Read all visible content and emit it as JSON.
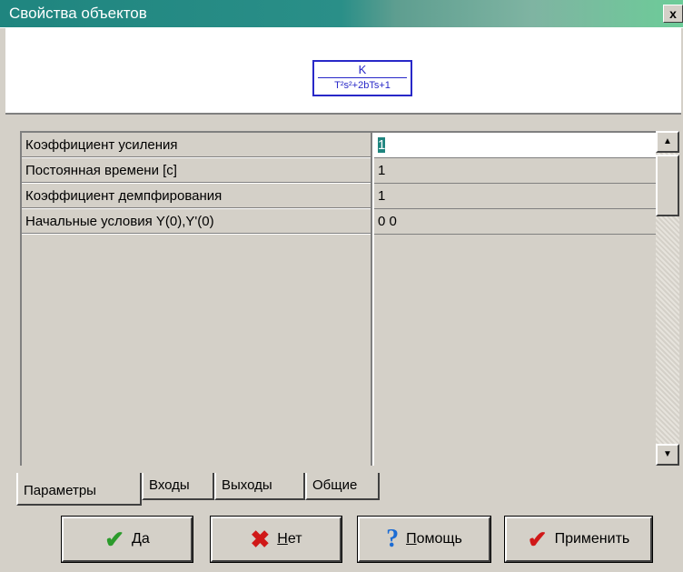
{
  "window": {
    "title": "Свойства объектов",
    "close_glyph": "x"
  },
  "preview": {
    "numerator": "K",
    "denominator": "T²s²+2bTs+1"
  },
  "params": [
    {
      "name": "Коэффициент усиления",
      "value": "1"
    },
    {
      "name": "Постоянная времени [c]",
      "value": "1"
    },
    {
      "name": "Коэффициент демпфирования",
      "value": "1"
    },
    {
      "name": "Начальные условия Y(0),Y'(0)",
      "value": "0 0"
    }
  ],
  "tabs": [
    {
      "label": "Параметры",
      "active": true
    },
    {
      "label": "Входы",
      "active": false
    },
    {
      "label": "Выходы",
      "active": false
    },
    {
      "label": "Общие",
      "active": false
    }
  ],
  "buttons": [
    {
      "accel": "Д",
      "rest": "а",
      "icon": "check-icon"
    },
    {
      "accel": "Н",
      "rest": "ет",
      "icon": "x-icon"
    },
    {
      "accel": "П",
      "rest": "омощь",
      "icon": "help-icon"
    },
    {
      "accel": "",
      "rest": "Применить",
      "icon": "apply-check-icon"
    }
  ],
  "colors": {
    "title_bar": "#1f857f",
    "formula": "#2828c8",
    "check": "#2c9b2c",
    "cross": "#d01818"
  }
}
